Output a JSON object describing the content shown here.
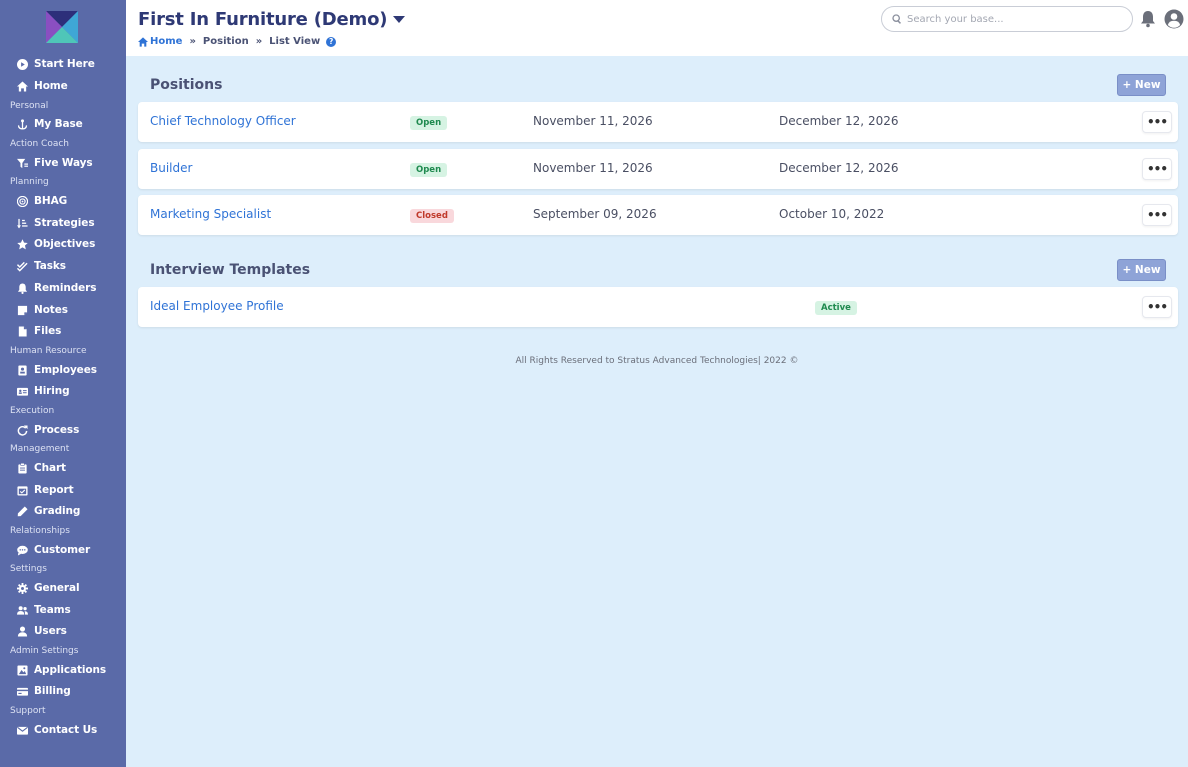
{
  "sidebar": {
    "items": [
      {
        "label": "Start Here",
        "icon": "play-circle-icon"
      },
      {
        "label": "Home",
        "icon": "home-icon"
      },
      {
        "section": "Personal"
      },
      {
        "label": "My Base",
        "icon": "anchor-icon"
      },
      {
        "section": "Action Coach"
      },
      {
        "label": "Five Ways",
        "icon": "filter-icon"
      },
      {
        "section": "Planning"
      },
      {
        "label": "BHAG",
        "icon": "target-icon"
      },
      {
        "label": "Strategies",
        "icon": "sort-icon"
      },
      {
        "label": "Objectives",
        "icon": "star-icon"
      },
      {
        "label": "Tasks",
        "icon": "check-double-icon"
      },
      {
        "label": "Reminders",
        "icon": "bell-icon"
      },
      {
        "label": "Notes",
        "icon": "sticky-note-icon"
      },
      {
        "label": "Files",
        "icon": "file-icon"
      },
      {
        "section": "Human Resource"
      },
      {
        "label": "Employees",
        "icon": "id-badge-icon"
      },
      {
        "label": "Hiring",
        "icon": "id-card-icon"
      },
      {
        "section": "Execution"
      },
      {
        "label": "Process",
        "icon": "redo-icon"
      },
      {
        "section": "Management"
      },
      {
        "label": "Chart",
        "icon": "clipboard-list-icon"
      },
      {
        "label": "Report",
        "icon": "calendar-check-icon"
      },
      {
        "label": "Grading",
        "icon": "pen-icon"
      },
      {
        "section": "Relationships"
      },
      {
        "label": "Customer",
        "icon": "comment-dots-icon"
      },
      {
        "section": "Settings"
      },
      {
        "label": "General",
        "icon": "cog-icon"
      },
      {
        "label": "Teams",
        "icon": "users-icon"
      },
      {
        "label": "Users",
        "icon": "user-icon"
      },
      {
        "section": "Admin Settings"
      },
      {
        "label": "Applications",
        "icon": "image-icon"
      },
      {
        "label": "Billing",
        "icon": "credit-card-icon"
      },
      {
        "section": "Support"
      },
      {
        "label": "Contact Us",
        "icon": "envelope-icon"
      }
    ]
  },
  "header": {
    "company": "First In Furniture (Demo)",
    "breadcrumb": {
      "home": "Home",
      "sep": "»",
      "items": [
        "Position",
        "List View"
      ]
    },
    "help": "?",
    "search_placeholder": "Search your base..."
  },
  "positions": {
    "title": "Positions",
    "new_label": "+ New",
    "rows": [
      {
        "title": "Chief Technology Officer",
        "status": "Open",
        "start": "November 11, 2026",
        "end": "December 12, 2026"
      },
      {
        "title": "Builder",
        "status": "Open",
        "start": "November 11, 2026",
        "end": "December 12, 2026"
      },
      {
        "title": "Marketing Specialist",
        "status": "Closed",
        "start": "September 09, 2026",
        "end": "October 10, 2022"
      }
    ]
  },
  "templates": {
    "title": "Interview Templates",
    "new_label": "+ New",
    "rows": [
      {
        "title": "Ideal Employee Profile",
        "status": "Active"
      }
    ]
  },
  "more_label": "•••",
  "footer": "All Rights Reserved to Stratus Advanced Technologies| 2022 ©",
  "colors": {
    "sidebar": "#5a6aa8",
    "background": "#ddeefb",
    "link": "#2f73d6",
    "new_button": "#8ea3d7"
  }
}
